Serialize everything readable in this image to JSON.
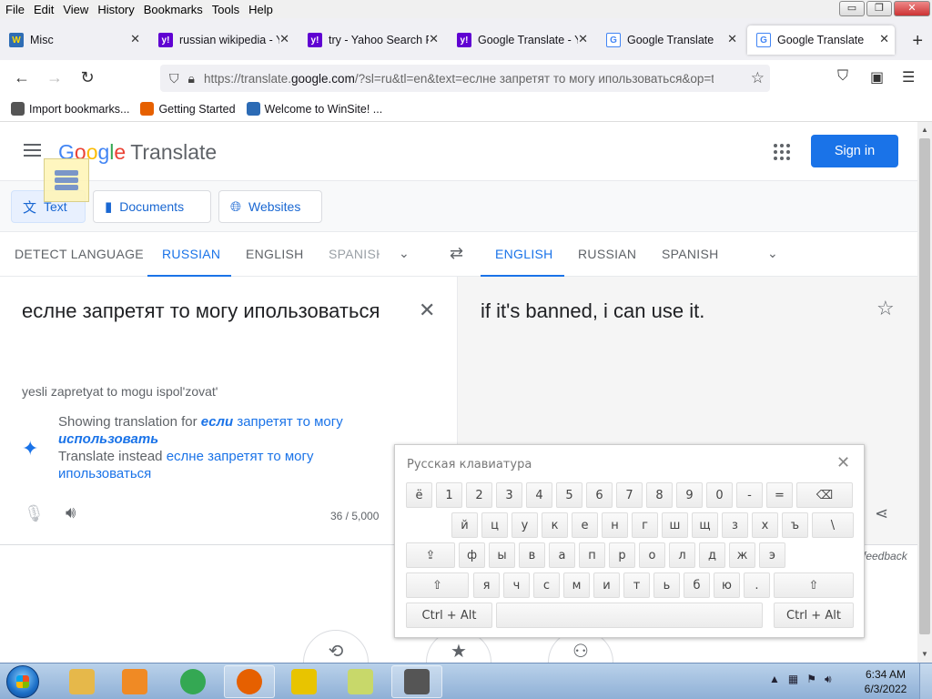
{
  "menu": [
    "File",
    "Edit",
    "View",
    "History",
    "Bookmarks",
    "Tools",
    "Help"
  ],
  "window_controls": {
    "minimize": "▭",
    "restore": "❐",
    "close": "✕"
  },
  "tabs": [
    {
      "label": "Misc",
      "favicon": "wiki",
      "active": false
    },
    {
      "label": "russian wikipedia - Yahoo",
      "favicon": "yahoo",
      "active": false
    },
    {
      "label": "try - Yahoo Search Results",
      "favicon": "yahoo",
      "active": false
    },
    {
      "label": "Google Translate - Yahoo",
      "favicon": "yahoo",
      "active": false
    },
    {
      "label": "Google Translate",
      "favicon": "gt",
      "active": false
    },
    {
      "label": "Google Translate",
      "favicon": "gt",
      "active": true
    }
  ],
  "url": {
    "prefix": "https://translate.",
    "domain": "google.com",
    "rest": "/?sl=ru&tl=en&text=еслне запретят то могу ипользоваться&op=translate"
  },
  "bookmarks": [
    {
      "label": "Import bookmarks...",
      "color": "#555555"
    },
    {
      "label": "Getting Started",
      "color": "#e66000"
    },
    {
      "label": "Welcome to WinSite! ...",
      "color": "#2c6bb5"
    }
  ],
  "header": {
    "logo": [
      "G",
      "o",
      "o",
      "g",
      "l",
      "e"
    ],
    "product": "Translate",
    "sign_in": "Sign in"
  },
  "modes": [
    {
      "label": "Text",
      "icon": "translate-icon",
      "active": true
    },
    {
      "label": "Documents",
      "icon": "document-icon",
      "active": false
    },
    {
      "label": "Websites",
      "icon": "globe-icon",
      "active": false
    }
  ],
  "source_langs": [
    "DETECT LANGUAGE",
    "RUSSIAN",
    "ENGLISH",
    "SPANISH"
  ],
  "source_selected": "RUSSIAN",
  "target_langs": [
    "ENGLISH",
    "RUSSIAN",
    "SPANISH"
  ],
  "target_selected": "ENGLISH",
  "source": {
    "text": "еслне запретят то могу ипользоваться",
    "transliteration": "yesli zapretyat to mogu ispol'zovat'",
    "showing_prefix": "Showing translation for",
    "showing_em1": "если",
    "showing_mid": "запретят то могу",
    "showing_em2": "использовать",
    "instead_prefix": "Translate instead",
    "instead_text": "еслне запретят то могу ипользоваться",
    "char_count": "36 / 5,000"
  },
  "target": {
    "text": "if it's banned, i can use it.",
    "feedback": "feedback"
  },
  "keyboard": {
    "title": "Русская клавиатура",
    "row1": [
      "ё",
      "1",
      "2",
      "3",
      "4",
      "5",
      "6",
      "7",
      "8",
      "9",
      "0",
      "-",
      "=",
      "⌫"
    ],
    "row2": [
      "й",
      "ц",
      "у",
      "к",
      "е",
      "н",
      "г",
      "ш",
      "щ",
      "з",
      "х",
      "ъ",
      "\\"
    ],
    "row3": [
      "⇪",
      "ф",
      "ы",
      "в",
      "а",
      "п",
      "р",
      "о",
      "л",
      "д",
      "ж",
      "э"
    ],
    "row4": [
      "⇧",
      "я",
      "ч",
      "с",
      "м",
      "и",
      "т",
      "ь",
      "б",
      "ю",
      ".",
      "⇧"
    ],
    "ctrl_alt": "Ctrl + Alt"
  },
  "taskbar": {
    "apps": [
      {
        "name": "explorer",
        "color": "#e6b84a"
      },
      {
        "name": "media-player",
        "color": "#f08a24"
      },
      {
        "name": "chrome",
        "color": "#34a853"
      },
      {
        "name": "firefox",
        "color": "#e66000"
      },
      {
        "name": "winamp",
        "color": "#e8c400"
      },
      {
        "name": "sticky-notes",
        "color": "#c8d86a"
      },
      {
        "name": "app-window",
        "color": "#555555"
      }
    ],
    "time": "6:34 AM",
    "date": "6/3/2022"
  }
}
